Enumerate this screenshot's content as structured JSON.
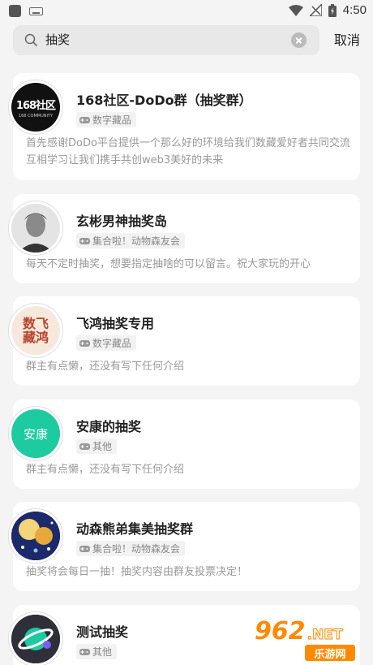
{
  "status_bar": {
    "time": "4:50"
  },
  "search": {
    "value": "抽奖",
    "cancel_label": "取消"
  },
  "results": [
    {
      "avatar": "168社区",
      "avatar_sub": "168 COMMUNITY",
      "title": "168社区-DoDo群（抽奖群）",
      "tag": "数字藏品",
      "description": "首先感谢DoDo平台提供一个那么好的环境给我们数藏爱好者共同交流互相学习让我们携手共创web3美好的未来"
    },
    {
      "title": "玄彬男神抽奖岛",
      "tag": "集合啦！动物森友会",
      "description": "每天不定时抽奖，想要指定抽啥的可以留言。祝大家玩的开心"
    },
    {
      "avatar": "数飞藏鸿",
      "title": "飞鸿抽奖专用",
      "tag": "数字藏品",
      "description": "群主有点懒，还没有写下任何介绍"
    },
    {
      "avatar": "安康",
      "title": "安康的抽奖",
      "tag": "其他",
      "description": "群主有点懒，还没有写下任何介绍"
    },
    {
      "title": "动森熊弟集美抽奖群",
      "tag": "集合啦！动物森友会",
      "description": "抽奖将会每日一抽！抽奖内容由群友投票决定！"
    },
    {
      "title": "测试抽奖",
      "tag": "其他",
      "description": ""
    }
  ],
  "watermark": {
    "number": "962",
    "suffix": ".NET",
    "site": "乐游网"
  },
  "colors": {
    "accent_green": "#1ecba0",
    "card_bg": "#ffffff",
    "page_bg": "#f4f4f4"
  }
}
